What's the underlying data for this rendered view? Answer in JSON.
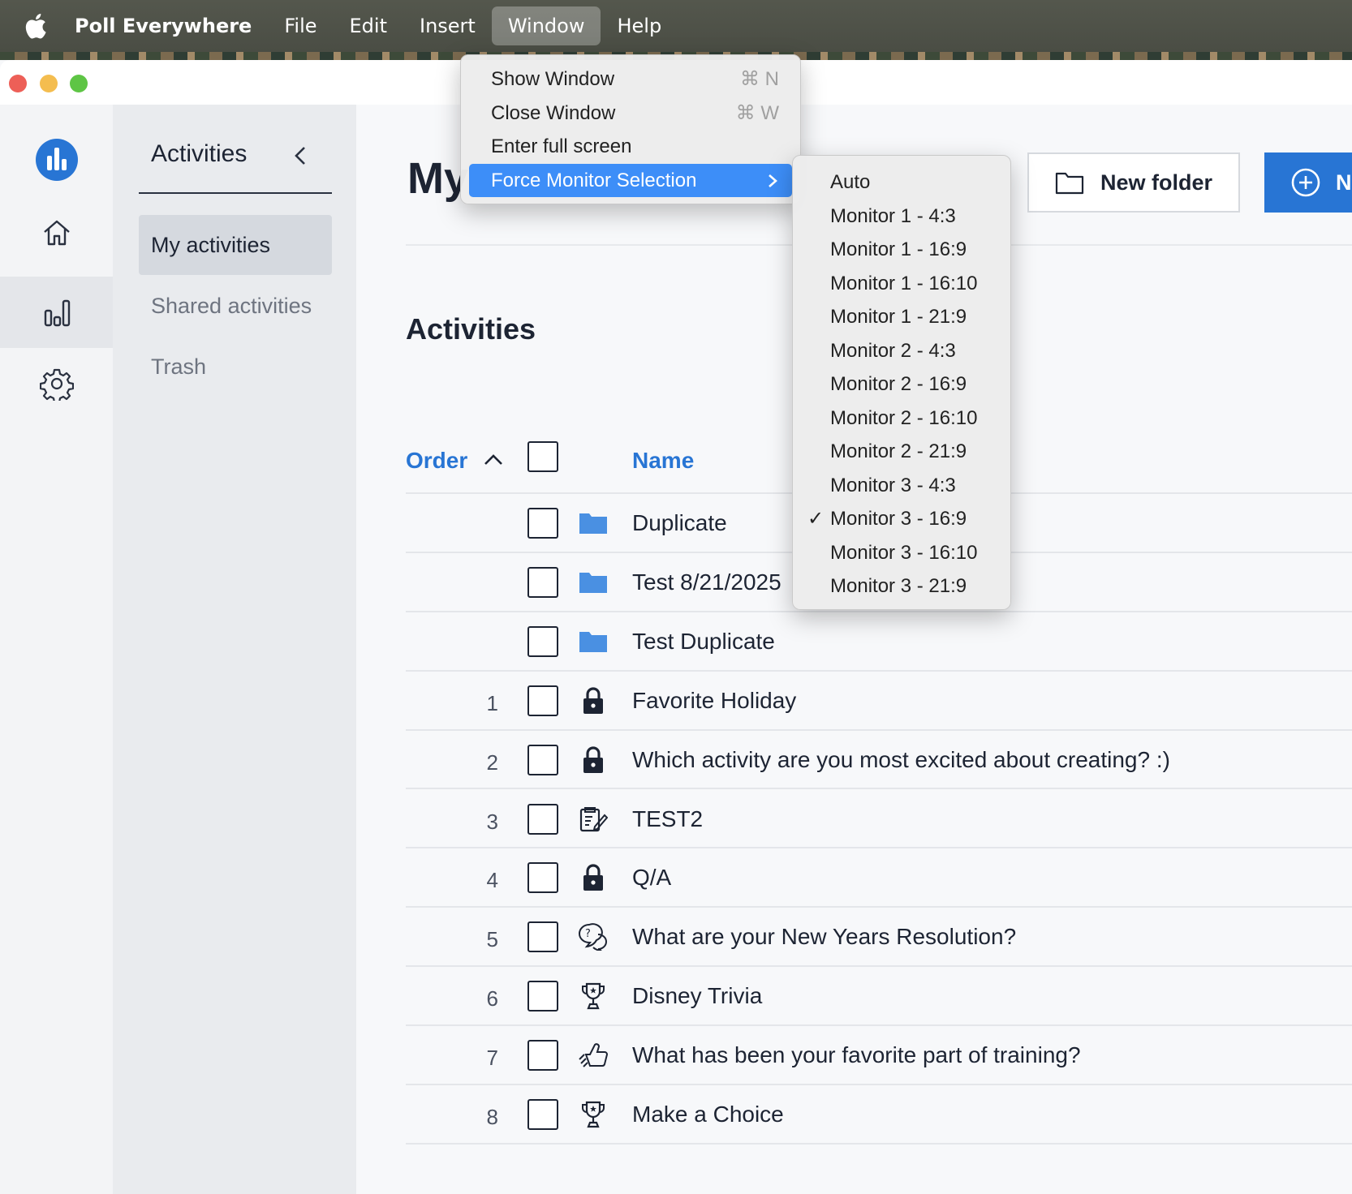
{
  "menubar": {
    "app_name": "Poll Everywhere",
    "menus": [
      "File",
      "Edit",
      "Insert",
      "Window",
      "Help"
    ],
    "active_menu": "Window"
  },
  "window_menu": {
    "items": [
      {
        "label": "Show Window",
        "shortcut": "⌘ N"
      },
      {
        "label": "Close Window",
        "shortcut": "⌘ W"
      },
      {
        "label": "Enter full screen",
        "shortcut": ""
      },
      {
        "label": "Force Monitor Selection",
        "shortcut": "",
        "submenu": true
      }
    ]
  },
  "monitor_menu": {
    "items": [
      "Auto",
      "Monitor 1 - 4:3",
      "Monitor 1 - 16:9",
      "Monitor 1 - 16:10",
      "Monitor 1 - 21:9",
      "Monitor 2 - 4:3",
      "Monitor 2 - 16:9",
      "Monitor 2 - 16:10",
      "Monitor 2 - 21:9",
      "Monitor 3 - 4:3",
      "Monitor 3 - 16:9",
      "Monitor 3 - 16:10",
      "Monitor 3 - 21:9"
    ],
    "checked": "Monitor 3 - 16:9",
    "check_mark": "✓"
  },
  "rail": {
    "items": [
      "logo-icon",
      "home-icon",
      "activities-icon",
      "settings-icon"
    ],
    "active": "activities-icon"
  },
  "subnav": {
    "heading": "Activities",
    "links": [
      "My activities",
      "Shared activities",
      "Trash"
    ],
    "active": "My activities"
  },
  "main": {
    "title": "My",
    "new_folder_label": "New folder",
    "new_label": "N",
    "section_title": "Activities",
    "columns": {
      "order": "Order",
      "name": "Name"
    },
    "rows": [
      {
        "order": "",
        "type": "folder-icon",
        "name": "Duplicate"
      },
      {
        "order": "",
        "type": "folder-icon",
        "name": "Test 8/21/2025"
      },
      {
        "order": "",
        "type": "folder-icon",
        "name": "Test Duplicate"
      },
      {
        "order": "1",
        "type": "lock-icon",
        "name": "Favorite Holiday"
      },
      {
        "order": "2",
        "type": "lock-icon",
        "name": "Which activity are you most excited about creating? :)"
      },
      {
        "order": "3",
        "type": "survey-icon",
        "name": "TEST2"
      },
      {
        "order": "4",
        "type": "lock-icon",
        "name": "Q/A"
      },
      {
        "order": "5",
        "type": "qa-icon",
        "name": "What are your New Years Resolution?"
      },
      {
        "order": "6",
        "type": "trophy-icon",
        "name": "Disney Trivia"
      },
      {
        "order": "7",
        "type": "thumbs-icon",
        "name": "What has been your favorite part of training?"
      },
      {
        "order": "8",
        "type": "trophy-icon",
        "name": "Make a Choice"
      }
    ]
  },
  "colors": {
    "accent": "#2875d4",
    "highlight": "#3d8ef8"
  }
}
